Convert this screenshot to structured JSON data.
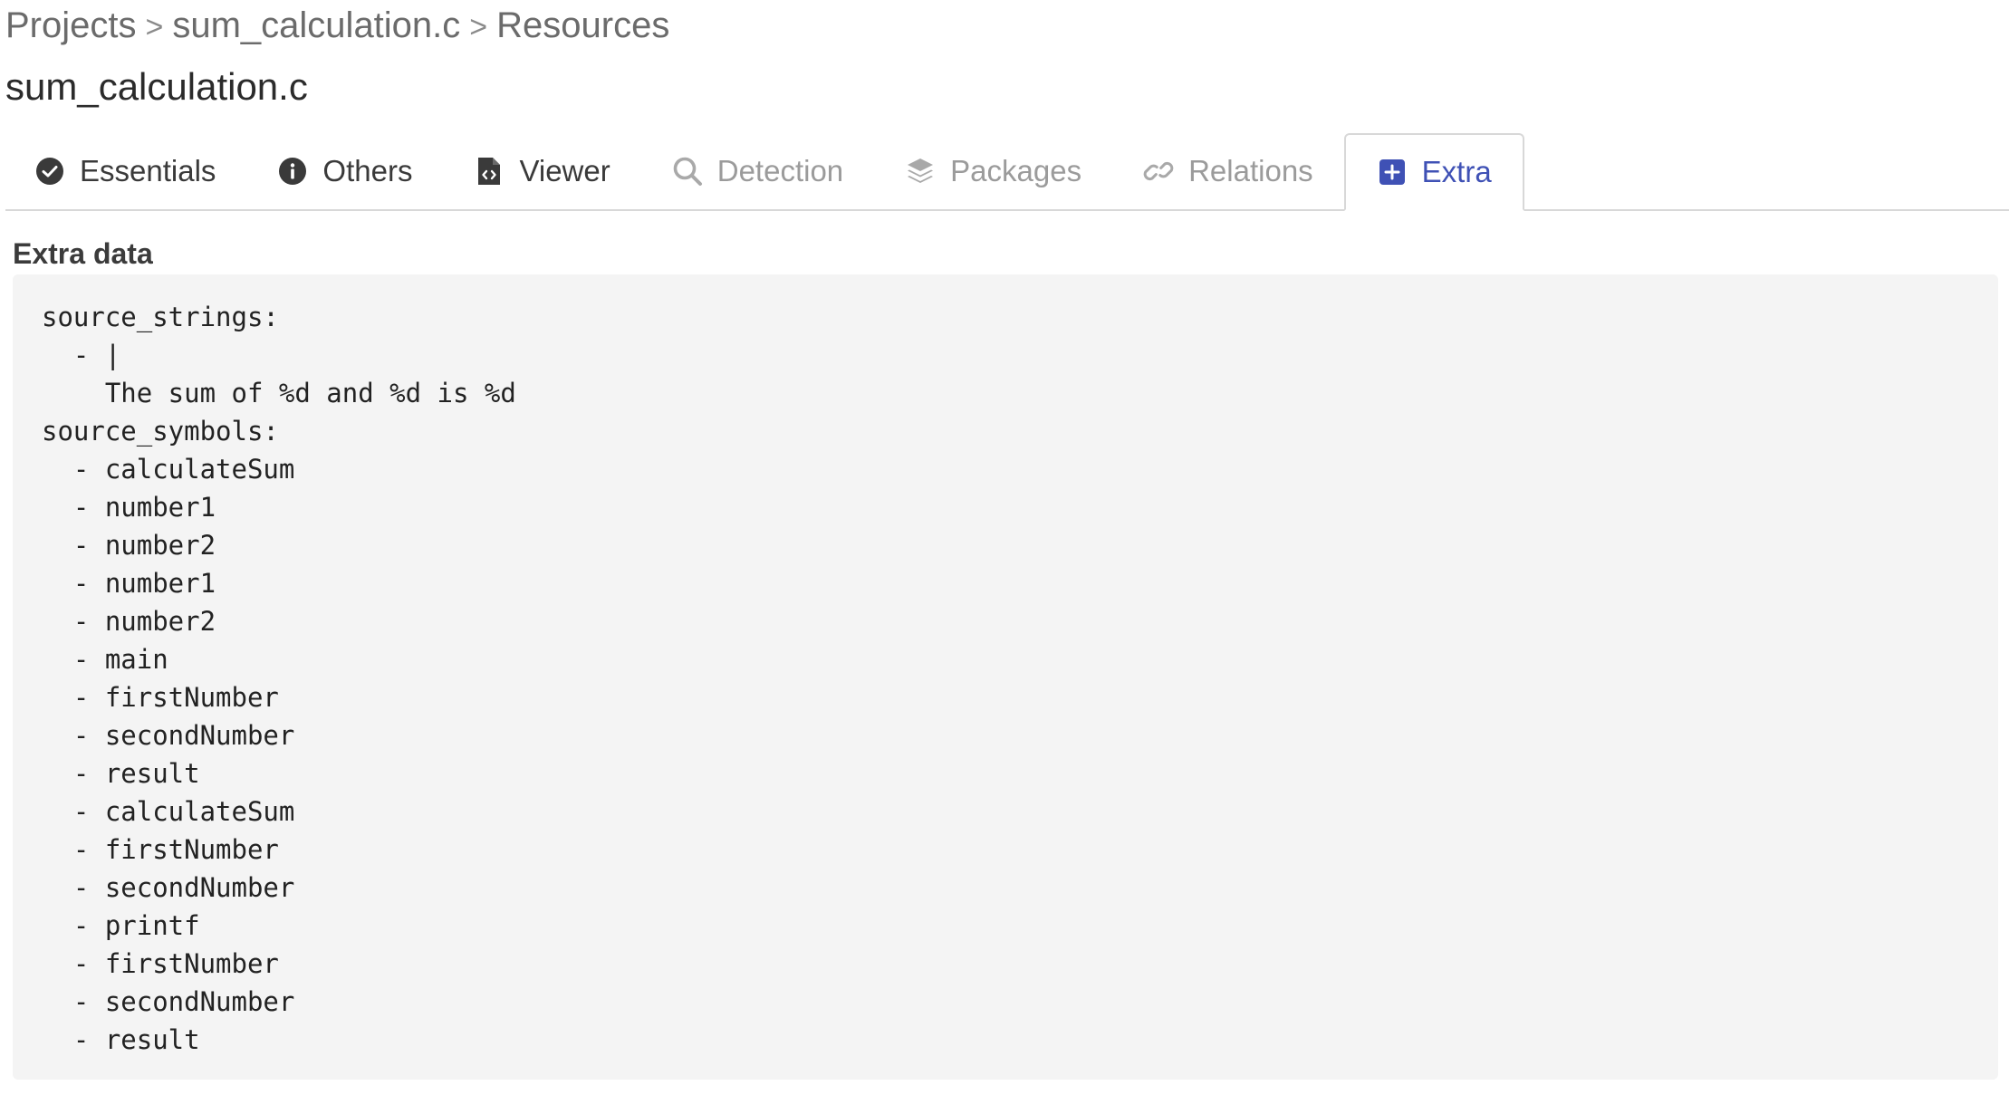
{
  "breadcrumb": {
    "items": [
      "Projects",
      "sum_calculation.c",
      "Resources"
    ],
    "separator": ">"
  },
  "page": {
    "title": "sum_calculation.c"
  },
  "tabs": [
    {
      "label": "Essentials",
      "icon": "check-circle-icon",
      "state": "enabled"
    },
    {
      "label": "Others",
      "icon": "info-circle-icon",
      "state": "enabled"
    },
    {
      "label": "Viewer",
      "icon": "file-code-icon",
      "state": "enabled"
    },
    {
      "label": "Detection",
      "icon": "search-icon",
      "state": "disabled"
    },
    {
      "label": "Packages",
      "icon": "layers-icon",
      "state": "disabled"
    },
    {
      "label": "Relations",
      "icon": "link-icon",
      "state": "disabled"
    },
    {
      "label": "Extra",
      "icon": "plus-square-icon",
      "state": "active"
    }
  ],
  "extra": {
    "section_label": "Extra data",
    "content": "source_strings:\n  - |\n    The sum of %d and %d is %d\nsource_symbols:\n  - calculateSum\n  - number1\n  - number2\n  - number1\n  - number2\n  - main\n  - firstNumber\n  - secondNumber\n  - result\n  - calculateSum\n  - firstNumber\n  - secondNumber\n  - printf\n  - firstNumber\n  - secondNumber\n  - result"
  },
  "colors": {
    "accent": "#3f51b5",
    "text": "#3a3a3a",
    "muted": "#9b9b9b",
    "code_bg": "#f4f4f4"
  }
}
